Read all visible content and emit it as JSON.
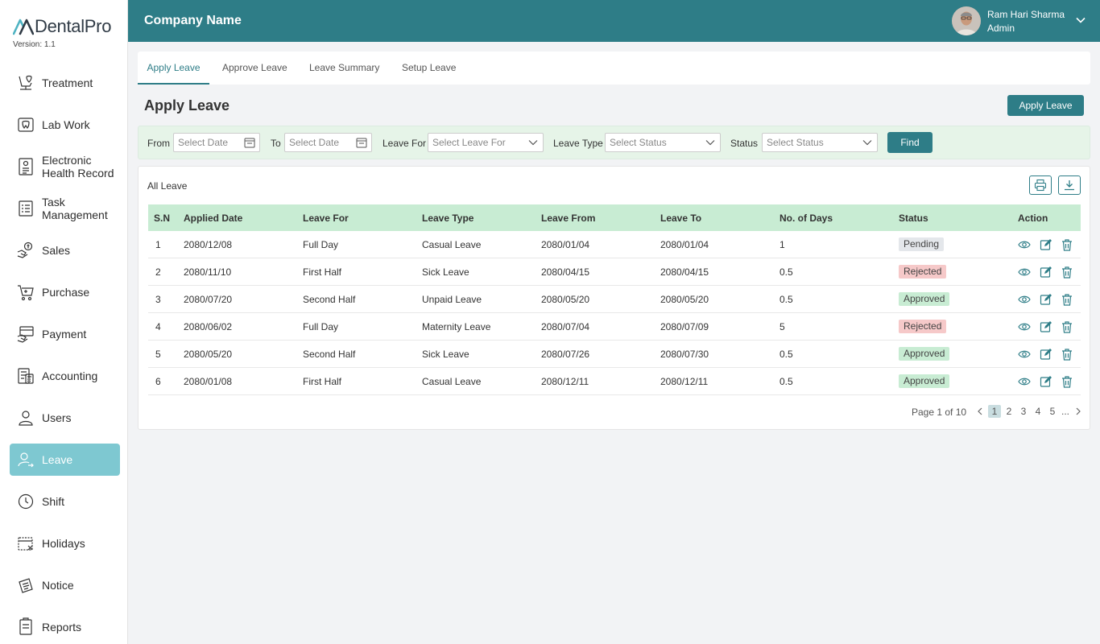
{
  "app": {
    "name": "DentalPro",
    "version": "Version: 1.1"
  },
  "sidebar": {
    "items": [
      {
        "label": "Treatment",
        "icon": "tooth-chair-icon"
      },
      {
        "label": "Lab Work",
        "icon": "lab-tooth-icon"
      },
      {
        "label": "Electronic Health Record",
        "icon": "health-record-icon"
      },
      {
        "label": "Task Management",
        "icon": "task-list-icon"
      },
      {
        "label": "Sales",
        "icon": "sales-hand-icon"
      },
      {
        "label": "Purchase",
        "icon": "cart-icon"
      },
      {
        "label": "Payment",
        "icon": "payment-hand-icon"
      },
      {
        "label": "Accounting",
        "icon": "accounting-icon"
      },
      {
        "label": "Users",
        "icon": "user-icon"
      },
      {
        "label": "Leave",
        "icon": "leave-user-icon",
        "active": true
      },
      {
        "label": "Shift",
        "icon": "clock-icon"
      },
      {
        "label": "Holidays",
        "icon": "calendar-icon"
      },
      {
        "label": "Notice",
        "icon": "notice-icon"
      },
      {
        "label": "Reports",
        "icon": "report-icon"
      }
    ]
  },
  "header": {
    "company": "Company Name",
    "user_name": "Ram Hari Sharma",
    "user_role": "Admin"
  },
  "tabs": [
    "Apply Leave",
    "Approve Leave",
    "Leave Summary",
    "Setup Leave"
  ],
  "page": {
    "title": "Apply Leave",
    "apply_button": "Apply Leave"
  },
  "filter": {
    "from_label": "From",
    "from_placeholder": "Select Date",
    "to_label": "To",
    "to_placeholder": "Select Date",
    "leave_for_label": "Leave For",
    "leave_for_placeholder": "Select Leave For",
    "leave_type_label": "Leave Type",
    "leave_type_placeholder": "Select Status",
    "status_label": "Status",
    "status_placeholder": "Select Status",
    "find_button": "Find"
  },
  "table": {
    "title": "All Leave",
    "columns": [
      "S.N",
      "Applied Date",
      "Leave For",
      "Leave Type",
      "Leave From",
      "Leave To",
      "No. of Days",
      "Status",
      "Action"
    ],
    "rows": [
      [
        "1",
        "2080/12/08",
        "Full Day",
        "Casual Leave",
        "2080/01/04",
        "2080/01/04",
        "1",
        "Pending"
      ],
      [
        "2",
        "2080/11/10",
        "First Half",
        "Sick Leave",
        "2080/04/15",
        "2080/04/15",
        "0.5",
        "Rejected"
      ],
      [
        "3",
        "2080/07/20",
        "Second Half",
        "Unpaid Leave",
        "2080/05/20",
        "2080/05/20",
        "0.5",
        "Approved"
      ],
      [
        "4",
        "2080/06/02",
        "Full Day",
        "Maternity Leave",
        "2080/07/04",
        "2080/07/09",
        "5",
        "Rejected"
      ],
      [
        "5",
        "2080/05/20",
        "Second Half",
        "Sick Leave",
        "2080/07/26",
        "2080/07/30",
        "0.5",
        "Approved"
      ],
      [
        "6",
        "2080/01/08",
        "First Half",
        "Casual Leave",
        "2080/12/11",
        "2080/12/11",
        "0.5",
        "Approved"
      ]
    ]
  },
  "pagination": {
    "label": "Page 1 of 10",
    "pages": [
      "1",
      "2",
      "3",
      "4",
      "5",
      "..."
    ],
    "current": "1"
  },
  "colors": {
    "primary": "#2e7d87",
    "active_nav": "#7ec8d1",
    "table_header": "#c8ecd3"
  }
}
